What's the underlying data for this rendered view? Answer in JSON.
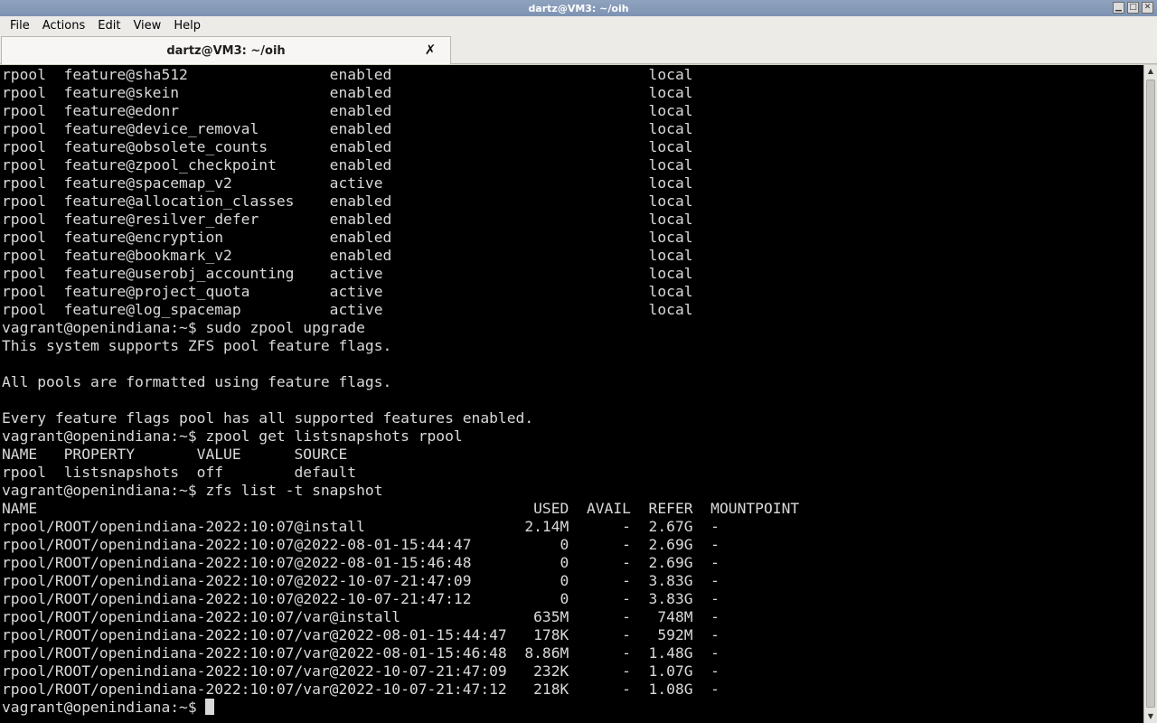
{
  "window": {
    "title": "dartz@VM3: ~/oih",
    "controls": {
      "minimize": "▁",
      "maximize": "□",
      "close": "✕"
    }
  },
  "menubar": {
    "items": [
      "File",
      "Actions",
      "Edit",
      "View",
      "Help"
    ]
  },
  "tab": {
    "title": "dartz@VM3: ~/oih",
    "close_glyph": "✗"
  },
  "terminal": {
    "lines": [
      "rpool  feature@sha512                enabled                             local",
      "rpool  feature@skein                 enabled                             local",
      "rpool  feature@edonr                 enabled                             local",
      "rpool  feature@device_removal        enabled                             local",
      "rpool  feature@obsolete_counts       enabled                             local",
      "rpool  feature@zpool_checkpoint      enabled                             local",
      "rpool  feature@spacemap_v2           active                              local",
      "rpool  feature@allocation_classes    enabled                             local",
      "rpool  feature@resilver_defer        enabled                             local",
      "rpool  feature@encryption            enabled                             local",
      "rpool  feature@bookmark_v2           enabled                             local",
      "rpool  feature@userobj_accounting    active                              local",
      "rpool  feature@project_quota         active                              local",
      "rpool  feature@log_spacemap          active                              local",
      "vagrant@openindiana:~$ sudo zpool upgrade",
      "This system supports ZFS pool feature flags.",
      "",
      "All pools are formatted using feature flags.",
      "",
      "Every feature flags pool has all supported features enabled.",
      "vagrant@openindiana:~$ zpool get listsnapshots rpool",
      "NAME   PROPERTY       VALUE      SOURCE",
      "rpool  listsnapshots  off        default",
      "vagrant@openindiana:~$ zfs list -t snapshot",
      "NAME                                                        USED  AVAIL  REFER  MOUNTPOINT",
      "rpool/ROOT/openindiana-2022:10:07@install                  2.14M      -  2.67G  -",
      "rpool/ROOT/openindiana-2022:10:07@2022-08-01-15:44:47          0      -  2.69G  -",
      "rpool/ROOT/openindiana-2022:10:07@2022-08-01-15:46:48          0      -  2.69G  -",
      "rpool/ROOT/openindiana-2022:10:07@2022-10-07-21:47:09          0      -  3.83G  -",
      "rpool/ROOT/openindiana-2022:10:07@2022-10-07-21:47:12          0      -  3.83G  -",
      "rpool/ROOT/openindiana-2022:10:07/var@install               635M      -   748M  -",
      "rpool/ROOT/openindiana-2022:10:07/var@2022-08-01-15:44:47   178K      -   592M  -",
      "rpool/ROOT/openindiana-2022:10:07/var@2022-08-01-15:46:48  8.86M      -  1.48G  -",
      "rpool/ROOT/openindiana-2022:10:07/var@2022-10-07-21:47:09   232K      -  1.07G  -",
      "rpool/ROOT/openindiana-2022:10:07/var@2022-10-07-21:47:12   218K      -  1.08G  -"
    ],
    "prompt": "vagrant@openindiana:~$ "
  },
  "scrollbar": {
    "up_glyph": "▲",
    "down_glyph": "▼"
  }
}
